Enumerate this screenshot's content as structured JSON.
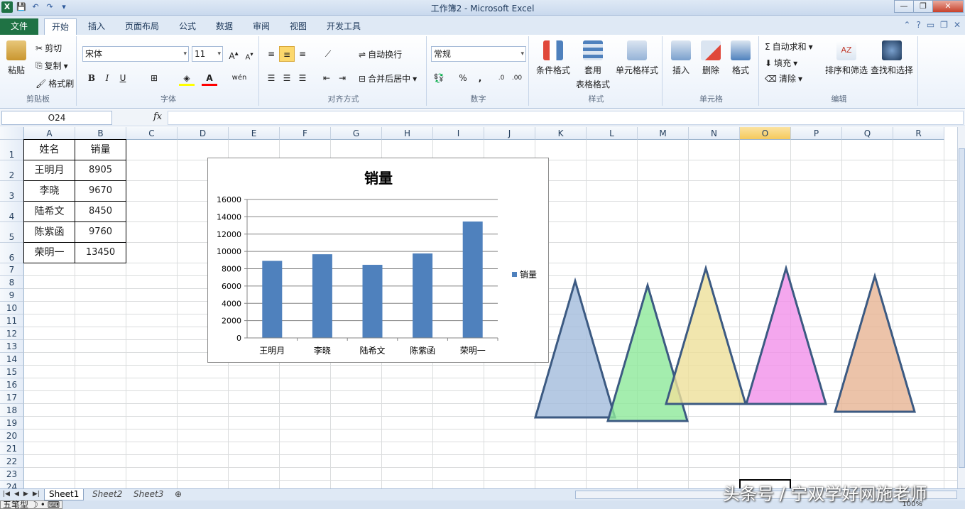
{
  "window": {
    "title": "工作簿2 - Microsoft Excel"
  },
  "tabs": [
    "文件",
    "开始",
    "插入",
    "页面布局",
    "公式",
    "数据",
    "审阅",
    "视图",
    "开发工具"
  ],
  "ribbon": {
    "clipboard": {
      "paste": "粘贴",
      "cut": "剪切",
      "copy": "复制",
      "format_painter": "格式刷",
      "label": "剪贴板"
    },
    "font": {
      "name": "宋体",
      "size": "11",
      "label": "字体",
      "bold": "B",
      "italic": "I",
      "underline": "U",
      "font_color": "A"
    },
    "alignment": {
      "wrap": "自动换行",
      "merge": "合并后居中",
      "label": "对齐方式"
    },
    "number": {
      "format": "常规",
      "percent": "%",
      "comma": ",",
      "label": "数字"
    },
    "styles": {
      "conditional": "条件格式",
      "table_1": "套用",
      "table_2": "表格格式",
      "cell_styles": "单元格样式",
      "label": "样式"
    },
    "cells": {
      "insert": "插入",
      "delete": "删除",
      "format": "格式",
      "label": "单元格"
    },
    "editing": {
      "autosum": "自动求和",
      "fill": "填充",
      "clear": "清除",
      "sort": "排序和筛选",
      "find": "查找和选择",
      "label": "编辑"
    }
  },
  "formula_bar": {
    "name_box": "O24",
    "fx": "fx",
    "value": ""
  },
  "columns": [
    "A",
    "B",
    "C",
    "D",
    "E",
    "F",
    "G",
    "H",
    "I",
    "J",
    "K",
    "L",
    "M",
    "N",
    "O",
    "P",
    "Q",
    "R"
  ],
  "rows": [
    "1",
    "2",
    "3",
    "4",
    "5",
    "6",
    "7",
    "8",
    "9",
    "10",
    "11",
    "12",
    "13",
    "14",
    "15",
    "16",
    "17",
    "18",
    "19",
    "20",
    "21",
    "22",
    "23",
    "24"
  ],
  "table": {
    "headers": [
      "姓名",
      "销量"
    ],
    "rows": [
      [
        "王明月",
        "8905"
      ],
      [
        "李晓",
        "9670"
      ],
      [
        "陆希文",
        "8450"
      ],
      [
        "陈紫函",
        "9760"
      ],
      [
        "荣明一",
        "13450"
      ]
    ]
  },
  "chart_data": {
    "type": "bar",
    "title": "销量",
    "categories": [
      "王明月",
      "李晓",
      "陆希文",
      "陈紫函",
      "荣明一"
    ],
    "series": [
      {
        "name": "销量",
        "values": [
          8905,
          9670,
          8450,
          9760,
          13450
        ],
        "color": "#4f81bd"
      }
    ],
    "ylim": [
      0,
      16000
    ],
    "yticks": [
      "0",
      "2000",
      "4000",
      "6000",
      "8000",
      "10000",
      "12000",
      "14000",
      "16000"
    ],
    "grid": true,
    "legend": "right"
  },
  "shapes": {
    "triangle_colors": [
      "#a3bbdc",
      "#8de89a",
      "#ede09a",
      "#f191ea",
      "#e7b494"
    ],
    "outline": "#3c5a82"
  },
  "sheet_tabs": [
    "Sheet1",
    "Sheet2",
    "Sheet3"
  ],
  "status": {
    "ime": "五笔型",
    "zoom": "100%"
  },
  "watermark": "头条号 / 宁双学好网施老师"
}
